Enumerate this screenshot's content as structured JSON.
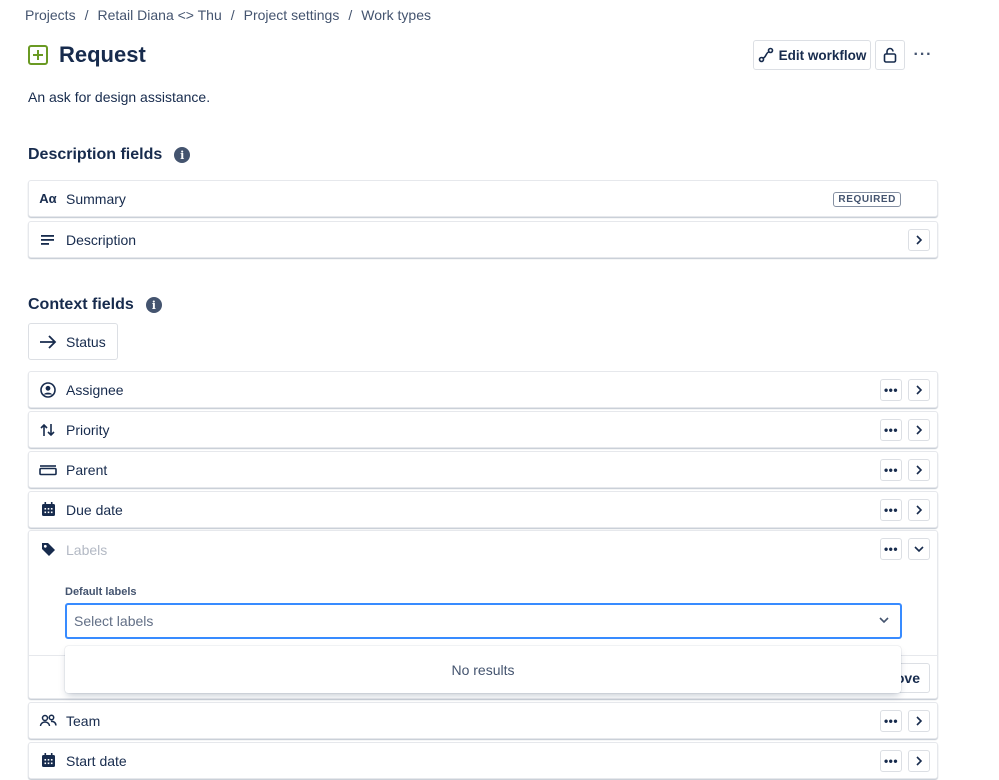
{
  "breadcrumb": [
    "Projects",
    "Retail Diana <> Thu",
    "Project settings",
    "Work types"
  ],
  "breadcrumb_separator": "/",
  "header": {
    "title": "Request",
    "icon": "plus-square-icon",
    "edit_workflow_label": "Edit workflow",
    "more_label": "···"
  },
  "description": "An ask for design assistance.",
  "description_fields": {
    "title": "Description fields",
    "items": [
      {
        "label": "Summary",
        "icon": "text-icon",
        "icon_text": "Aα",
        "badge": "REQUIRED"
      },
      {
        "label": "Description",
        "icon": "align-left-icon"
      }
    ]
  },
  "context_fields": {
    "title": "Context fields",
    "status_label": "Status",
    "items": [
      {
        "label": "Assignee",
        "icon": "person-circle-icon"
      },
      {
        "label": "Priority",
        "icon": "arrows-up-down-icon"
      },
      {
        "label": "Parent",
        "icon": "parent-icon"
      },
      {
        "label": "Due date",
        "icon": "calendar-icon"
      },
      {
        "label": "Labels",
        "icon": "tag-icon"
      },
      {
        "label": "Team",
        "icon": "people-icon"
      },
      {
        "label": "Start date",
        "icon": "calendar-icon"
      }
    ]
  },
  "labels_panel": {
    "default_label": "Default labels",
    "select_placeholder": "Select labels",
    "remove_label": "ove",
    "dropdown_empty": "No results"
  },
  "colors": {
    "accent": "#388bff",
    "icon_green": "#6a9a23"
  }
}
